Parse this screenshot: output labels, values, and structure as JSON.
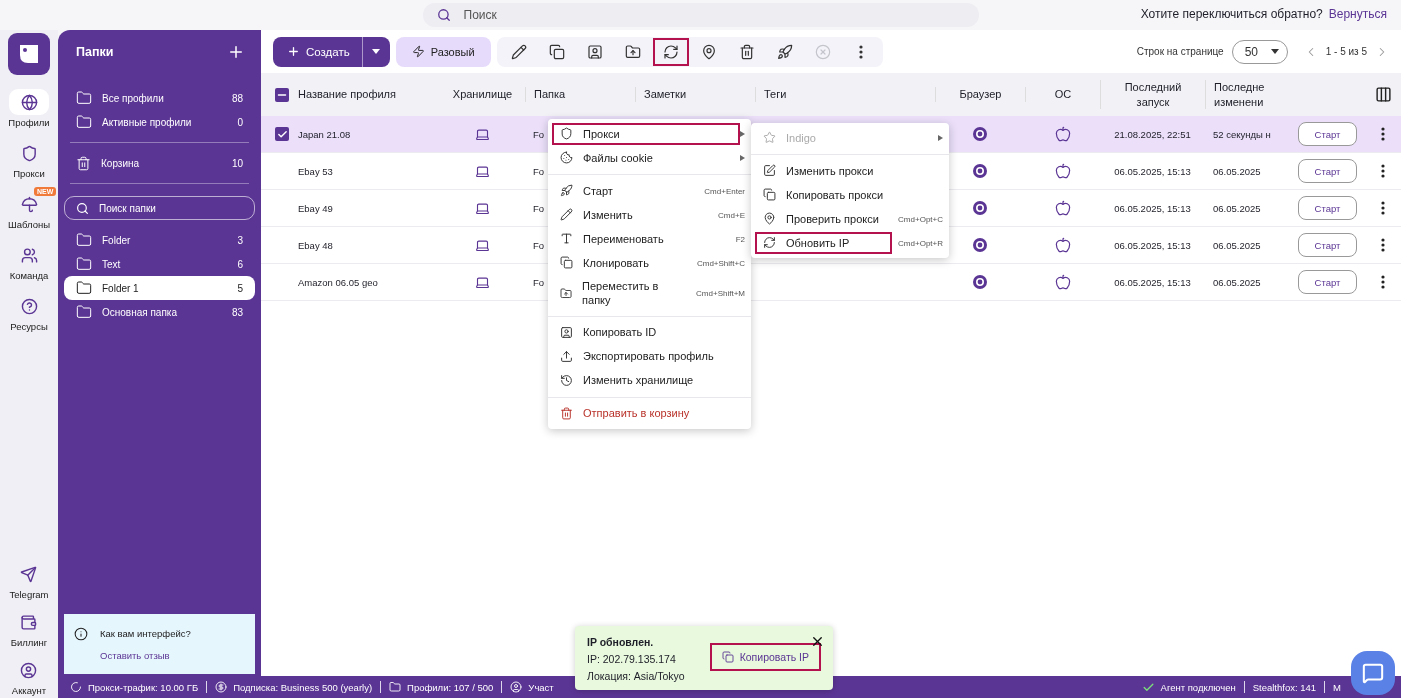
{
  "top_bar": {
    "search": {
      "placeholder": "Поиск"
    },
    "switch_prompt": "Хотите переключиться обратно?",
    "switch_link": "Вернуться"
  },
  "nav": {
    "items": [
      {
        "label": "Профили",
        "selected": true
      },
      {
        "label": "Прокси",
        "selected": false
      },
      {
        "label": "Шаблоны",
        "selected": false,
        "badge": "NEW"
      },
      {
        "label": "Команда",
        "selected": false
      },
      {
        "label": "Ресурсы",
        "selected": false
      }
    ],
    "bottom_items": [
      {
        "label": "Telegram"
      },
      {
        "label": "Биллинг"
      },
      {
        "label": "Аккаунт"
      }
    ]
  },
  "folders": {
    "title": "Папки",
    "system": [
      {
        "label": "Все профили",
        "count": "88",
        "selected": false
      },
      {
        "label": "Активные профили",
        "count": "0",
        "selected": false
      }
    ],
    "trash": {
      "label": "Корзина",
      "count": "10"
    },
    "search": {
      "placeholder": "Поиск папки"
    },
    "items": [
      {
        "label": "Folder",
        "count": "3",
        "selected": false
      },
      {
        "label": "Text",
        "count": "6",
        "selected": false
      },
      {
        "label": "Folder 1",
        "count": "5",
        "selected": true
      },
      {
        "label": "Основная папка",
        "count": "83",
        "selected": false
      }
    ],
    "feedback": {
      "question": "Как вам интерфейс?",
      "link": "Оставить отзыв"
    }
  },
  "toolbar": {
    "create": "Создать",
    "one_time": "Разовый",
    "actions": [
      {
        "kind": "edit",
        "disabled": false,
        "highlighted": false
      },
      {
        "kind": "clone",
        "disabled": false,
        "highlighted": false
      },
      {
        "kind": "copy_id",
        "disabled": false,
        "highlighted": false
      },
      {
        "kind": "move",
        "disabled": false,
        "highlighted": false
      },
      {
        "kind": "refresh",
        "disabled": false,
        "highlighted": true
      },
      {
        "kind": "location",
        "disabled": false,
        "highlighted": false
      },
      {
        "kind": "delete",
        "disabled": false,
        "highlighted": false
      },
      {
        "kind": "start",
        "disabled": false,
        "highlighted": false
      },
      {
        "kind": "stop",
        "disabled": true,
        "highlighted": false
      },
      {
        "kind": "more",
        "disabled": false,
        "highlighted": false
      }
    ],
    "rows_label": "Строк на странице",
    "rows_per_page": "50",
    "range": "1 - 5 из 5"
  },
  "table": {
    "header_checkbox": {
      "indeterminate": true
    },
    "columns": [
      "Название профиля",
      "Хранилище",
      "Папка",
      "Заметки",
      "Теги",
      "Браузер",
      "ОС",
      "Последний запуск",
      "Последне изменени"
    ],
    "rows": [
      {
        "name": "Japan 21.08",
        "folder": "Fo",
        "last_launch": "21.08.2025, 22:51",
        "last_change": "52 секунды н",
        "action": "Старт",
        "selected": true
      },
      {
        "name": "Ebay 53",
        "folder": "Fo",
        "last_launch": "06.05.2025, 15:13",
        "last_change": "06.05.2025",
        "action": "Старт",
        "selected": false
      },
      {
        "name": "Ebay 49",
        "folder": "Fo",
        "last_launch": "06.05.2025, 15:13",
        "last_change": "06.05.2025",
        "action": "Старт",
        "selected": false
      },
      {
        "name": "Ebay 48",
        "folder": "Fo",
        "last_launch": "06.05.2025, 15:13",
        "last_change": "06.05.2025",
        "action": "Старт",
        "selected": false
      },
      {
        "name": "Amazon 06.05 geo",
        "folder": "Fo",
        "last_launch": "06.05.2025, 15:13",
        "last_change": "06.05.2025",
        "action": "Старт",
        "selected": false
      }
    ]
  },
  "context_menu": {
    "items": [
      {
        "kind": "submenu",
        "label": "Прокси",
        "highlighted": true
      },
      {
        "kind": "submenu",
        "label": "Файлы cookie",
        "highlighted": false
      },
      {
        "kind": "divider"
      },
      {
        "kind": "item",
        "label": "Старт",
        "shortcut": "Cmd+Enter"
      },
      {
        "kind": "item",
        "label": "Изменить",
        "shortcut": "Cmd+E"
      },
      {
        "kind": "item",
        "label": "Переименовать",
        "shortcut": "F2"
      },
      {
        "kind": "item",
        "label": "Клонировать",
        "shortcut": "Cmd+Shift+C"
      },
      {
        "kind": "item",
        "label": "Переместить в папку",
        "shortcut": "Cmd+Shift+M"
      },
      {
        "kind": "divider"
      },
      {
        "kind": "item",
        "label": "Копировать ID"
      },
      {
        "kind": "item",
        "label": "Экспортировать профиль"
      },
      {
        "kind": "item",
        "label": "Изменить хранилище"
      },
      {
        "kind": "divider"
      },
      {
        "kind": "danger",
        "label": "Отправить в корзину"
      }
    ]
  },
  "proxy_submenu": {
    "items": [
      {
        "kind": "submenu",
        "label": "Indigo",
        "disabled": true
      },
      {
        "kind": "divider"
      },
      {
        "kind": "item",
        "label": "Изменить прокси",
        "highlighted": false
      },
      {
        "kind": "item",
        "label": "Копировать прокси",
        "highlighted": false
      },
      {
        "kind": "item",
        "label": "Проверить прокси",
        "shortcut": "Cmd+Opt+C",
        "highlighted": false
      },
      {
        "kind": "item",
        "label": "Обновить IP",
        "shortcut": "Cmd+Opt+R",
        "highlighted": true
      }
    ]
  },
  "toast": {
    "title": "IP обновлен.",
    "lines": [
      "IP: 202.79.135.174",
      "Локация: Asia/Tokyo"
    ],
    "action": "Копировать IP",
    "highlighted": true
  },
  "status_bar": {
    "left": [
      "Прокси-трафик: 10.00 ГБ",
      "Подписка: Business 500 (yearly)",
      "Профили: 107 / 500",
      "Участ"
    ],
    "right": [
      "Агент подключен",
      "Stealthfox: 141",
      "M"
    ]
  }
}
